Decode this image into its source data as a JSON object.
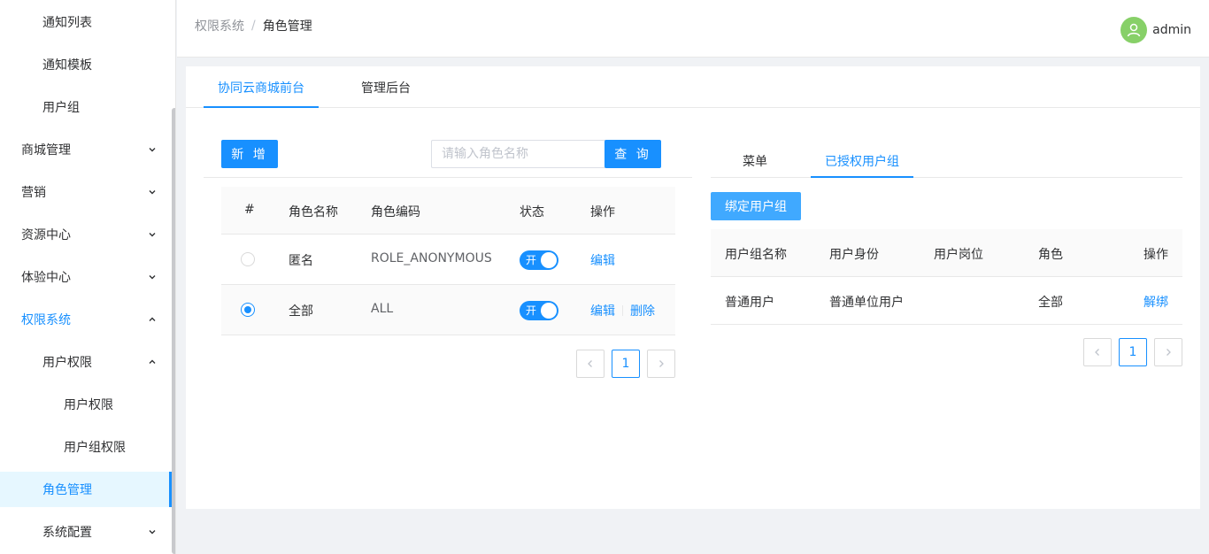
{
  "sidebar": {
    "items": [
      {
        "label": "通知列表"
      },
      {
        "label": "通知模板"
      },
      {
        "label": "用户组"
      },
      {
        "label": "商城管理"
      },
      {
        "label": "营销"
      },
      {
        "label": "资源中心"
      },
      {
        "label": "体验中心"
      },
      {
        "label": "权限系统"
      },
      {
        "label": "用户权限"
      },
      {
        "label": "用户权限"
      },
      {
        "label": "用户组权限"
      },
      {
        "label": "角色管理"
      },
      {
        "label": "系统配置"
      }
    ]
  },
  "header": {
    "breadcrumb": {
      "parent": "权限系统",
      "separator": "/",
      "current": "角色管理"
    },
    "user": {
      "name": "admin"
    }
  },
  "top_tabs": [
    {
      "label": "协同云商城前台",
      "active": true
    },
    {
      "label": "管理后台",
      "active": false
    }
  ],
  "toolbar": {
    "add_label": "新 增",
    "search_placeholder": "请输入角色名称",
    "search_label": "查 询"
  },
  "role_table": {
    "headers": [
      "#",
      "角色名称",
      "角色编码",
      "状态",
      "操作"
    ],
    "rows": [
      {
        "name": "匿名",
        "code": "ROLE_ANONYMOUS",
        "status": "开",
        "actions": [
          "编辑"
        ],
        "selected": false
      },
      {
        "name": "全部",
        "code": "ALL",
        "status": "开",
        "actions": [
          "编辑",
          "删除"
        ],
        "selected": true
      }
    ],
    "pagination": {
      "current": "1"
    }
  },
  "right_panel": {
    "tabs": [
      {
        "label": "菜单",
        "active": false
      },
      {
        "label": "已授权用户组",
        "active": true
      }
    ],
    "bind_label": "绑定用户组",
    "headers": [
      "用户组名称",
      "用户身份",
      "用户岗位",
      "角色",
      "操作"
    ],
    "rows": [
      {
        "group": "普通用户",
        "identity": "普通单位用户",
        "post": "",
        "role": "全部",
        "action": "解绑"
      }
    ],
    "pagination": {
      "current": "1"
    }
  },
  "colors": {
    "primary": "#1890ff",
    "avatar": "#87d068"
  }
}
